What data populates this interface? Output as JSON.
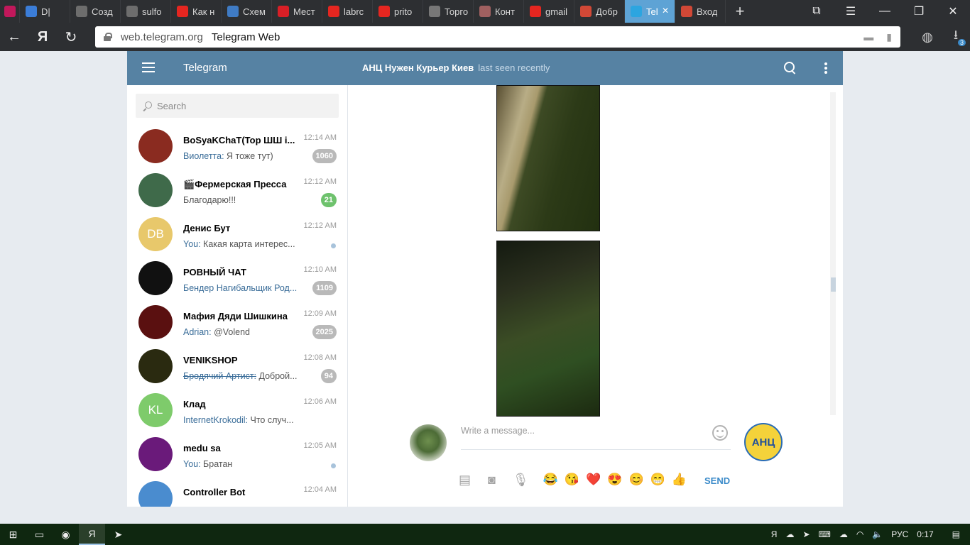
{
  "browser": {
    "tabs": [
      {
        "label": "",
        "icon": "telegram-pink-icon",
        "color": "#c1185b"
      },
      {
        "label": "D|",
        "icon": "video-icon",
        "color": "#3b7dd8"
      },
      {
        "label": "Созд",
        "icon": "cloud-icon",
        "color": "#6d6d6d"
      },
      {
        "label": "sulfo",
        "icon": "cloud-icon",
        "color": "#6d6d6d"
      },
      {
        "label": "Как н",
        "icon": "yandex-icon",
        "color": "#e52620"
      },
      {
        "label": "Схем",
        "icon": "a-icon",
        "color": "#3f7bc4"
      },
      {
        "label": "Мест",
        "icon": "n-icon",
        "color": "#d81f26"
      },
      {
        "label": "labrc",
        "icon": "yandex-icon",
        "color": "#e52620"
      },
      {
        "label": "prito",
        "icon": "yandex-icon",
        "color": "#e52620"
      },
      {
        "label": "Торго",
        "icon": "page-icon",
        "color": "#777777"
      },
      {
        "label": "Конт",
        "icon": "image-icon",
        "color": "#a06060"
      },
      {
        "label": "gmail",
        "icon": "yandex-icon",
        "color": "#e52620"
      },
      {
        "label": "Добр",
        "icon": "gmail-icon",
        "color": "#d14836"
      },
      {
        "label": "Tel",
        "icon": "telegram-icon",
        "color": "#2ca5e0",
        "active": true
      },
      {
        "label": "Вход",
        "icon": "gmail-icon",
        "color": "#d14836"
      }
    ],
    "new_tab": "+",
    "address": {
      "domain": "web.telegram.org",
      "page_title": "Telegram Web"
    },
    "downloads_count": "3"
  },
  "telegram": {
    "app_title": "Telegram",
    "peer": {
      "name": "АНЦ Нужен Курьер Киев",
      "status": "last seen recently"
    },
    "search_placeholder": "Search",
    "dialogs": [
      {
        "name": "BoSyaKChaT(Top ШШ i...",
        "time": "12:14 AM",
        "from": "Виолетта:",
        "text": " Я тоже тут)",
        "badge": "1060",
        "avatar_color": "#8a2b20",
        "initials": ""
      },
      {
        "name": "🎬Фермерская Пресса",
        "time": "12:12 AM",
        "from": "",
        "text": "Благодарю!!!",
        "badge": "21",
        "badge_green": true,
        "avatar_color": "#3f6a4a",
        "initials": ""
      },
      {
        "name": "Денис Бут",
        "time": "12:12 AM",
        "from": "You:",
        "text": " Какая карта интерес...",
        "badge": "",
        "dot": true,
        "avatar_color": "#e8c86b",
        "initials": "DB"
      },
      {
        "name": "РОВНЫЙ ЧАТ",
        "time": "12:10 AM",
        "from": "Бендер Нагибальщик Род...",
        "text": "",
        "badge": "1109",
        "avatar_color": "#111111",
        "initials": ""
      },
      {
        "name": "Мафия Дяди Шишкина",
        "time": "12:09 AM",
        "from": "Adrian:",
        "text": " @Volend",
        "badge": "2025",
        "avatar_color": "#5a1010",
        "initials": ""
      },
      {
        "name": "VENIKSHOP",
        "time": "12:08 AM",
        "from": "Бродячий Артист:",
        "text": " Доброй...",
        "strike": true,
        "badge": "94",
        "avatar_color": "#2a2a10",
        "initials": ""
      },
      {
        "name": "Клад",
        "time": "12:06 AM",
        "from": "InternetKrokodil:",
        "text": " Что случ...",
        "badge": "",
        "avatar_color": "#7ecb6b",
        "initials": "KL"
      },
      {
        "name": "medu sa",
        "time": "12:05 AM",
        "from": "You:",
        "text": " Братан",
        "badge": "",
        "dot": true,
        "avatar_color": "#6a1a7a",
        "initials": ""
      },
      {
        "name": "Controller Bot",
        "time": "12:04 AM",
        "from": "",
        "text": "",
        "badge": "",
        "avatar_color": "#4a8ccf",
        "initials": ""
      }
    ],
    "composer": {
      "placeholder": "Write a message...",
      "peer_avatar_text": "АНЦ",
      "emojis": [
        "😂",
        "😘",
        "❤️",
        "😍",
        "😊",
        "😁",
        "👍"
      ],
      "send_label": "SEND"
    }
  },
  "taskbar": {
    "language": "РУС",
    "clock": "0:17"
  }
}
